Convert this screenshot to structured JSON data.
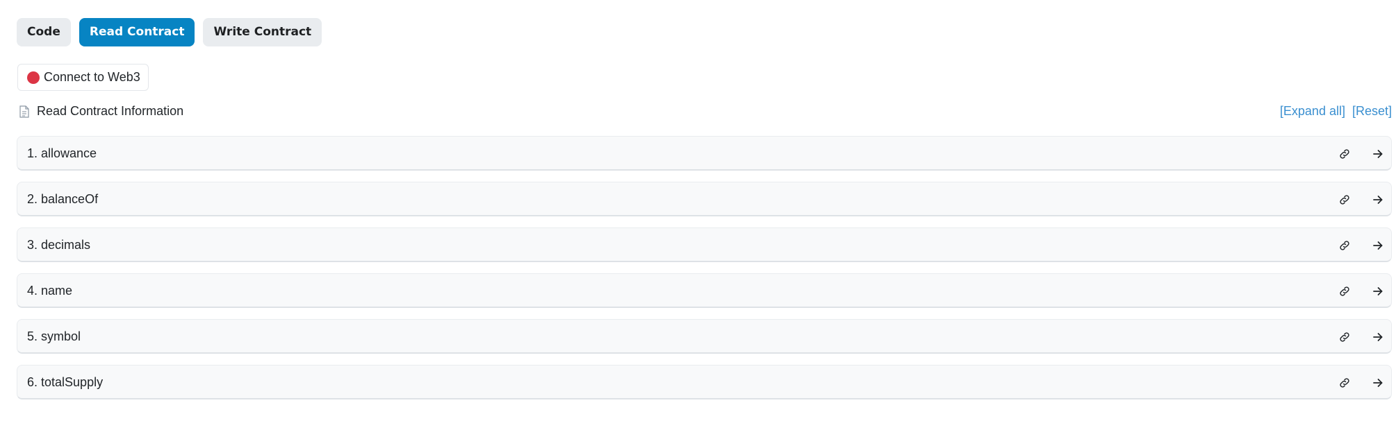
{
  "tabs": [
    {
      "label": "Code",
      "active": false
    },
    {
      "label": "Read Contract",
      "active": true
    },
    {
      "label": "Write Contract",
      "active": false
    }
  ],
  "connect": {
    "label": "Connect to Web3",
    "status_color": "#dc3545"
  },
  "section": {
    "title": "Read Contract Information",
    "icon": "document-icon",
    "expand_all_label": "[Expand all]",
    "reset_label": "[Reset]"
  },
  "functions": [
    {
      "label": "1. allowance"
    },
    {
      "label": "2. balanceOf"
    },
    {
      "label": "3. decimals"
    },
    {
      "label": "4. name"
    },
    {
      "label": "5. symbol"
    },
    {
      "label": "6. totalSupply"
    }
  ],
  "icons": {
    "row_link": "link-icon",
    "row_expand": "arrow-right-icon"
  },
  "colors": {
    "accent": "#0784c3",
    "link": "#3a8fd0",
    "disconnected": "#dc3545"
  }
}
